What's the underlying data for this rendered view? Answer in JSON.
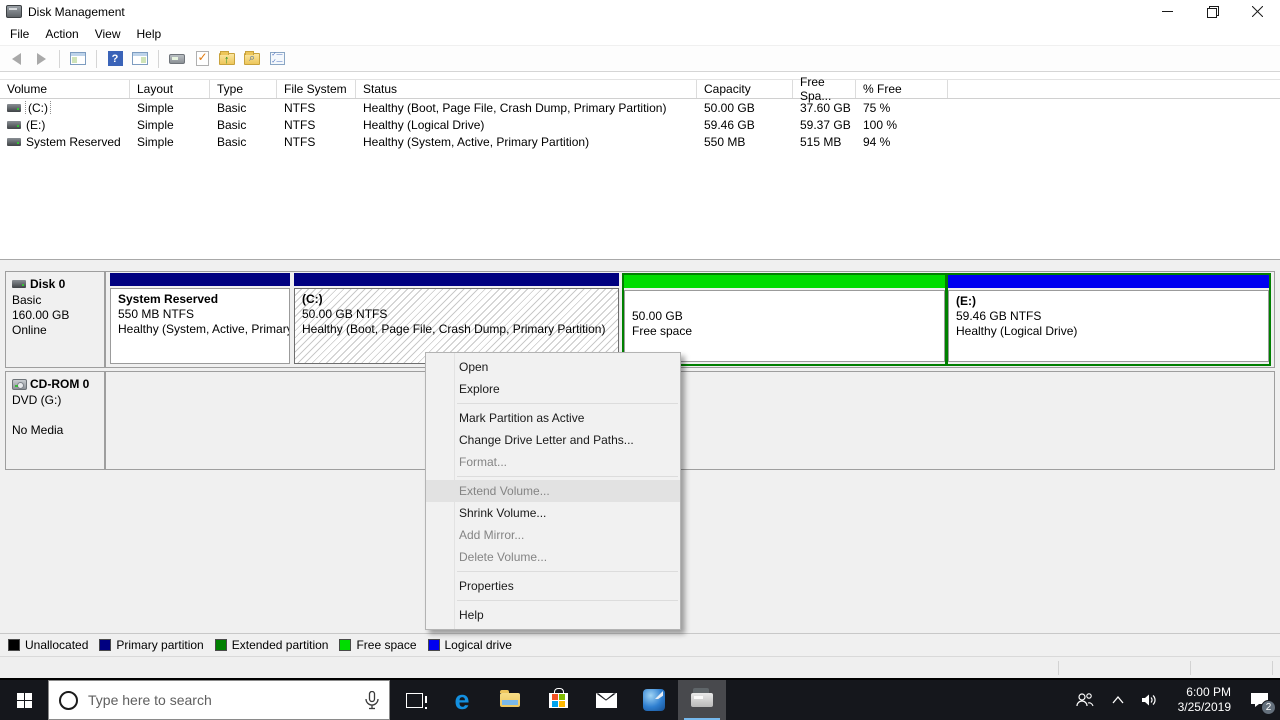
{
  "window": {
    "title": "Disk Management"
  },
  "menu_bar": {
    "file": "File",
    "action": "Action",
    "view": "View",
    "help": "Help"
  },
  "colors": {
    "primary": "#000080",
    "extended": "#008000",
    "free": "#00dd00",
    "logical": "#0000f0",
    "unallocated": "#000000",
    "taskbar_accent": "#76b9ed"
  },
  "volume_table": {
    "columns": {
      "volume": "Volume",
      "layout": "Layout",
      "type": "Type",
      "fs": "File System",
      "status": "Status",
      "capacity": "Capacity",
      "free": "Free Spa...",
      "pct": "% Free"
    },
    "rows": [
      {
        "volume": "(C:)",
        "layout": "Simple",
        "type": "Basic",
        "fs": "NTFS",
        "status": "Healthy (Boot, Page File, Crash Dump, Primary Partition)",
        "capacity": "50.00 GB",
        "free": "37.60 GB",
        "pct": "75 %"
      },
      {
        "volume": "(E:)",
        "layout": "Simple",
        "type": "Basic",
        "fs": "NTFS",
        "status": "Healthy (Logical Drive)",
        "capacity": "59.46 GB",
        "free": "59.37 GB",
        "pct": "100 %"
      },
      {
        "volume": "System Reserved",
        "layout": "Simple",
        "type": "Basic",
        "fs": "NTFS",
        "status": "Healthy (System, Active, Primary Partition)",
        "capacity": "550 MB",
        "free": "515 MB",
        "pct": "94 %"
      }
    ]
  },
  "disk0": {
    "name": "Disk 0",
    "type": "Basic",
    "size": "160.00 GB",
    "status": "Online",
    "partitions": {
      "system_reserved": {
        "title": "System Reserved",
        "line2": "550 MB NTFS",
        "line3": "Healthy (System, Active, Primary"
      },
      "c": {
        "title": "(C:)",
        "line2": "50.00 GB NTFS",
        "line3": "Healthy (Boot, Page File, Crash Dump, Primary Partition)"
      },
      "free": {
        "line2": "50.00 GB",
        "line3": "Free space"
      },
      "e": {
        "title": "(E:)",
        "line2": "59.46 GB NTFS",
        "line3": "Healthy (Logical Drive)"
      }
    }
  },
  "cdrom": {
    "name": "CD-ROM 0",
    "type": "DVD (G:)",
    "status": "No Media"
  },
  "context_menu": {
    "items": [
      {
        "label": "Open"
      },
      {
        "label": "Explore"
      },
      {
        "label": "Mark Partition as Active"
      },
      {
        "label": "Change Drive Letter and Paths..."
      },
      {
        "label": "Format..."
      },
      {
        "label": "Extend Volume..."
      },
      {
        "label": "Shrink Volume..."
      },
      {
        "label": "Add Mirror..."
      },
      {
        "label": "Delete Volume..."
      },
      {
        "label": "Properties"
      },
      {
        "label": "Help"
      }
    ]
  },
  "legend": {
    "unallocated": "Unallocated",
    "primary": "Primary partition",
    "extended": "Extended partition",
    "free": "Free space",
    "logical": "Logical drive"
  },
  "taskbar": {
    "search_placeholder": "Type here to search",
    "time": "6:00 PM",
    "date": "3/25/2019",
    "notification_count": "2"
  }
}
